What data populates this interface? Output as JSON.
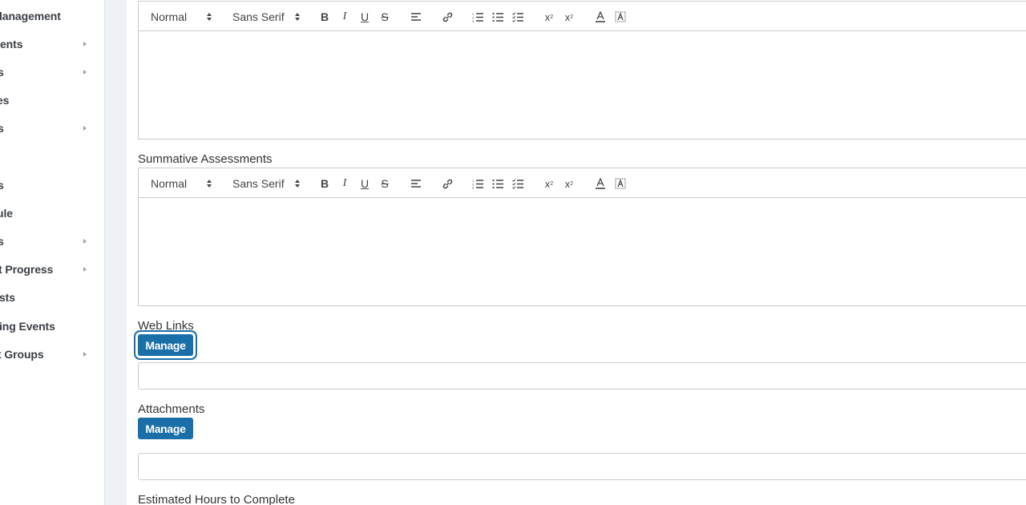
{
  "sidebar": {
    "items": [
      {
        "label": "lanagement",
        "caret": false
      },
      {
        "label": "ents",
        "caret": true
      },
      {
        "label": "s",
        "caret": true
      },
      {
        "label": "es",
        "caret": false
      },
      {
        "label": "s",
        "caret": true
      },
      {
        "label": "s",
        "caret": false
      },
      {
        "label": "ule",
        "caret": false
      },
      {
        "label": "s",
        "caret": true
      },
      {
        "label": "t Progress",
        "caret": true
      },
      {
        "label": "sts",
        "caret": false
      },
      {
        "label": "ing Events",
        "caret": false
      },
      {
        "label": "t Groups",
        "caret": true
      }
    ]
  },
  "editor_toolbar": {
    "size_select": "Normal",
    "font_select": "Sans Serif",
    "icons": [
      "bold-icon",
      "italic-icon",
      "underline-icon",
      "strike-icon",
      "align-icon",
      "link-icon",
      "ordered-list-icon",
      "bullet-list-icon",
      "check-list-icon",
      "subscript-icon",
      "superscript-icon",
      "text-color-icon",
      "background-color-icon"
    ]
  },
  "fields": {
    "summative_label": "Summative Assessments",
    "web_links_label": "Web Links",
    "web_links_button": "Manage",
    "attachments_label": "Attachments",
    "attachments_button": "Manage",
    "estimated_hours_label": "Estimated Hours to Complete"
  },
  "colors": {
    "accent": "#1a6fa8",
    "border": "#cccccc",
    "gutter": "#eef1f5"
  }
}
